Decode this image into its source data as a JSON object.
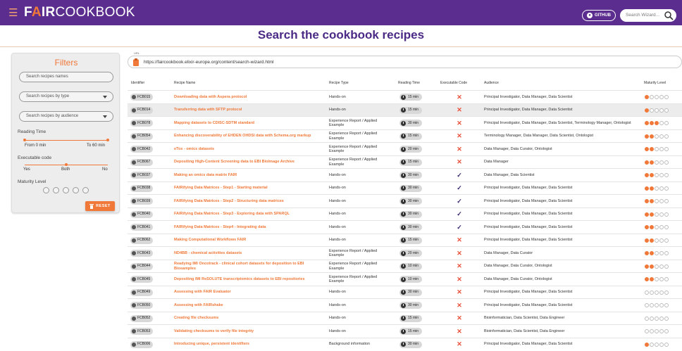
{
  "nav": {
    "logo_fair_f": "F",
    "logo_fair_a": "A",
    "logo_fair_ir": "IR",
    "logo_cook": "COOKBOOK",
    "github_label": "GITHUB",
    "search_placeholder": "Search Wizard...",
    "icons": [
      "menu-icon",
      "github-icon",
      "search-icon"
    ]
  },
  "page": {
    "title": "Search the cookbook recipes"
  },
  "filters": {
    "title": "Filters",
    "name_placeholder": "Search recipes names",
    "type_placeholder": "Search recipes by type",
    "audience_placeholder": "Search recipes by audience",
    "reading_time_label": "Reading Time",
    "reading_time_min": "From 0 min",
    "reading_time_max": "To 60 min",
    "executable_label": "Executable code",
    "exe_yes": "Yes",
    "exe_both": "Both",
    "exe_no": "No",
    "maturity_label": "Maturity Level",
    "reset_label": "RESET"
  },
  "url": {
    "legend": "URL",
    "value": "https://faircookbook.elixir-europe.org/content/search-wizard.html"
  },
  "table": {
    "headers": [
      "Identifier",
      "Recipe Name",
      "Recipe Type",
      "Reading Time",
      "Executable Code",
      "Audience",
      "Maturity Level"
    ],
    "rows": [
      {
        "id": "FCB015",
        "name": "Downloading data with Aspera protocol",
        "type": "Hands-on",
        "time": "15 min",
        "exe": false,
        "audience": "Principal Investigator, Data Manager, Data Scientist",
        "maturity": 1
      },
      {
        "id": "FCB014",
        "name": "Transferring data with SFTP protocol",
        "type": "Hands-on",
        "time": "15 min",
        "exe": false,
        "audience": "Principal Investigator, Data Manager, Data Scientist",
        "maturity": 1
      },
      {
        "id": "FCB078",
        "name": "Mapping datasets to CDISC-SDTM standard",
        "type": "Experience Report / Applied Example",
        "time": "30 min",
        "exe": false,
        "audience": "Principal Investigator, Data Manager, Data Scientist, Terminology Manager, Ontologist",
        "maturity": 3
      },
      {
        "id": "FCB054",
        "name": "Enhancing discoverability of EHDEN OHDSI data with Schema.org markup",
        "type": "Experience Report / Applied Example",
        "time": "15 min",
        "exe": false,
        "audience": "Terminology Manager, Data Manager, Data Scientist, Ontologist",
        "maturity": 2
      },
      {
        "id": "FCB042",
        "name": "eTox - omics datasets",
        "type": "Experience Report / Applied Example",
        "time": "20 min",
        "exe": false,
        "audience": "Data Manager, Data Curator, Ontologist",
        "maturity": 2
      },
      {
        "id": "FCB067",
        "name": "Depositing High-Content Screening data to EBI Biolmage Archive",
        "type": "Experience Report / Applied Example",
        "time": "15 min",
        "exe": false,
        "audience": "Data Manager",
        "maturity": 2
      },
      {
        "id": "FCB037",
        "name": "Making an omics data matrix FAIR",
        "type": "Hands-on",
        "time": "30 min",
        "exe": true,
        "audience": "Data Manager, Data Scientist",
        "maturity": 2
      },
      {
        "id": "FCB038",
        "name": "FAIRifying Data Matrices - Step1 - Starting material",
        "type": "Hands-on",
        "time": "30 min",
        "exe": true,
        "audience": "Principal Investigator, Data Manager, Data Scientist",
        "maturity": 2
      },
      {
        "id": "FCB039",
        "name": "FAIRifying Data Matrices - Step2 - Structuring data matrices",
        "type": "Hands-on",
        "time": "30 min",
        "exe": true,
        "audience": "Principal Investigator, Data Manager, Data Scientist",
        "maturity": 2
      },
      {
        "id": "FCB040",
        "name": "FAIRifying Data Matrices - Step3 - Exploring data with SPARQL",
        "type": "Hands-on",
        "time": "30 min",
        "exe": true,
        "audience": "Principal Investigator, Data Manager, Data Scientist",
        "maturity": 2
      },
      {
        "id": "FCB041",
        "name": "FAIRifying Data Matrices - Step4 - Integrating data",
        "type": "Hands-on",
        "time": "30 min",
        "exe": true,
        "audience": "Principal Investigator, Data Manager, Data Scientist",
        "maturity": 2
      },
      {
        "id": "FCB062",
        "name": "Making Computational Workflows FAIR",
        "type": "Hands-on",
        "time": "15 min",
        "exe": false,
        "audience": "Principal Investigator, Data Manager, Data Scientist",
        "maturity": 2
      },
      {
        "id": "FCB043",
        "name": "ND4BB - chemical activities datasets",
        "type": "Experience Report / Applied Example",
        "time": "20 min",
        "exe": false,
        "audience": "Data Manager, Data Curator",
        "maturity": 2
      },
      {
        "id": "FCB044",
        "name": "Readying IMI Oncotrack - clinical cohort datasets for deposition to EBI Biosamples",
        "type": "Experience Report / Applied Example",
        "time": "10 min",
        "exe": false,
        "audience": "Data Manager, Data Curator, Ontologist",
        "maturity": 2
      },
      {
        "id": "FCB045",
        "name": "Depositing IMI ReSOLUTE transcriptomics datasets to EBI repositories",
        "type": "Experience Report / Applied Example",
        "time": "10 min",
        "exe": false,
        "audience": "Data Manager, Data Curator, Ontologist",
        "maturity": 2
      },
      {
        "id": "FCB049",
        "name": "Assessing with FAIR Evaluator",
        "type": "Hands-on",
        "time": "30 min",
        "exe": false,
        "audience": "Principal Investigator, Data Manager, Data Scientist",
        "maturity": 0
      },
      {
        "id": "FCB050",
        "name": "Assessing with FAIRshake",
        "type": "Hands-on",
        "time": "30 min",
        "exe": false,
        "audience": "Principal Investigator, Data Manager, Data Scientist",
        "maturity": 0
      },
      {
        "id": "FCB052",
        "name": "Creating file checksums",
        "type": "Hands-on",
        "time": "15 min",
        "exe": false,
        "audience": "Bioinformatician, Data Scientist, Data Engineer",
        "maturity": 0
      },
      {
        "id": "FCB053",
        "name": "Validating checksums to verify file integrity",
        "type": "Hands-on",
        "time": "15 min",
        "exe": false,
        "audience": "Bioinformatician, Data Scientist, Data Engineer",
        "maturity": 0
      },
      {
        "id": "FCB006",
        "name": "Introducing unique, persistent identifiers",
        "type": "Background information",
        "time": "30 min",
        "exe": false,
        "audience": "Principal Investigator, Data Manager, Data Scientist",
        "maturity": 1
      }
    ],
    "maturity_max": 5
  },
  "colors": {
    "nav": "#5b2d8e",
    "accent": "#f07838",
    "title": "#4b2a86",
    "cross": "#e8503a",
    "check": "#3a2470"
  }
}
